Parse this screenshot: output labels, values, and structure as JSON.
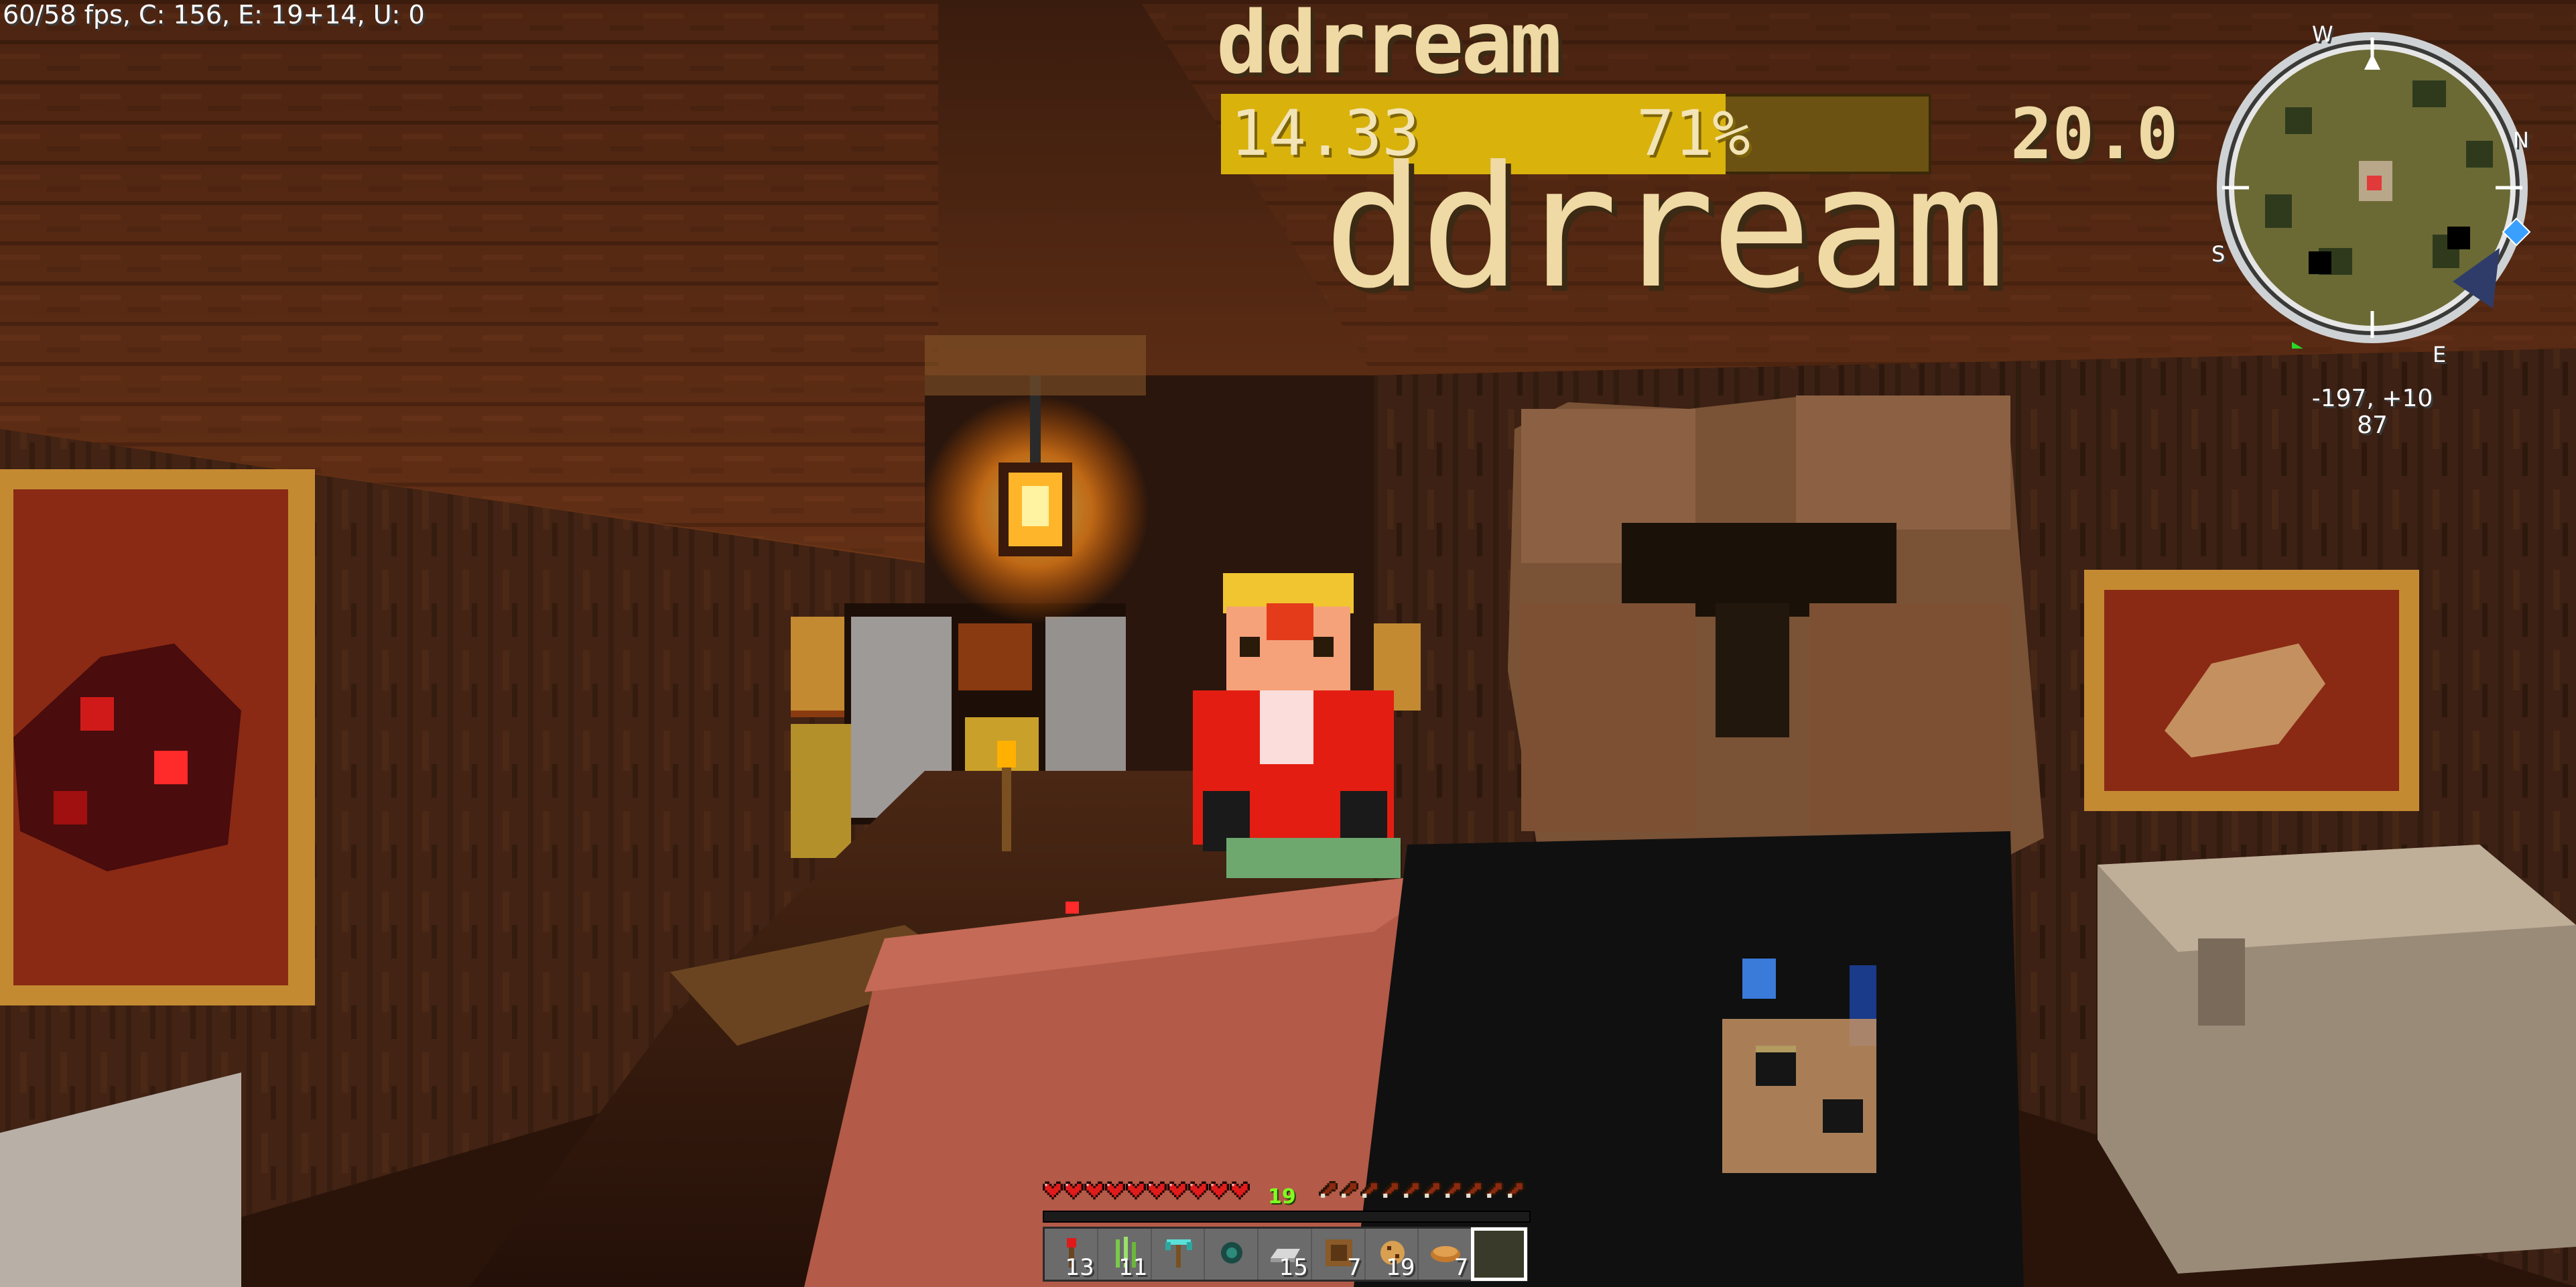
{
  "debug": {
    "text": "60/58 fps, C: 156, E: 19+14, U: 0"
  },
  "target": {
    "name": "ddrream",
    "bar_value": "14.33",
    "bar_percent_label": "71%",
    "bar_fill": 0.71,
    "health": "20.0",
    "nameplate": "ddrream",
    "bar_color": "#d9b20c"
  },
  "minimap": {
    "compass": {
      "north": "N",
      "west": "W",
      "south": "S",
      "east": "E"
    },
    "coords": "-197, +10",
    "height": "87"
  },
  "status": {
    "hearts": 10,
    "armor": "19",
    "hunger_slots": 10,
    "xp_fill": 0.0,
    "heart_color": "#e01b1b",
    "armor_color": "#80ff20"
  },
  "hotbar": {
    "selected": 8,
    "slots": [
      {
        "icon": "redstone-torch-icon",
        "count": "13"
      },
      {
        "icon": "sugar-cane-icon",
        "count": "11"
      },
      {
        "icon": "diamond-pickaxe-icon",
        "count": ""
      },
      {
        "icon": "ender-pearl-icon",
        "count": ""
      },
      {
        "icon": "iron-ingot-icon",
        "count": "15"
      },
      {
        "icon": "item-frame-icon",
        "count": "7"
      },
      {
        "icon": "cookie-icon",
        "count": "19"
      },
      {
        "icon": "bread-icon",
        "count": "7"
      },
      {
        "icon": "empty-slot",
        "count": ""
      }
    ]
  }
}
